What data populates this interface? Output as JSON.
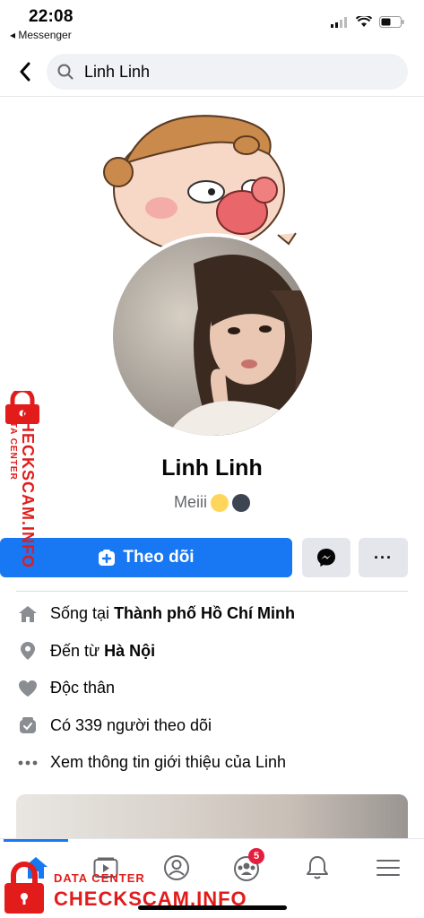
{
  "status_bar": {
    "time": "22:08",
    "back_app": "◂ Messenger"
  },
  "search": {
    "query": "Linh Linh"
  },
  "profile": {
    "name": "Linh Linh",
    "bio": "Meiii"
  },
  "actions": {
    "follow_label": "Theo dõi",
    "more_label": "···"
  },
  "info": {
    "lives_prefix": "Sống tại ",
    "lives_city": "Thành phố Hồ Chí Minh",
    "from_prefix": "Đến từ ",
    "from_city": "Hà Nội",
    "relationship": "Độc thân",
    "followers": "Có 339 người theo dõi",
    "see_about": "Xem thông tin giới thiệu của Linh"
  },
  "tabs": {
    "groups_badge": "5"
  },
  "watermark": {
    "brand": "CHECKSCAM.INFO",
    "subtitle": "DATA CENTER"
  },
  "colors": {
    "accent": "#1877f2",
    "badge": "#e41e3f",
    "watermark": "#e21b1b"
  }
}
